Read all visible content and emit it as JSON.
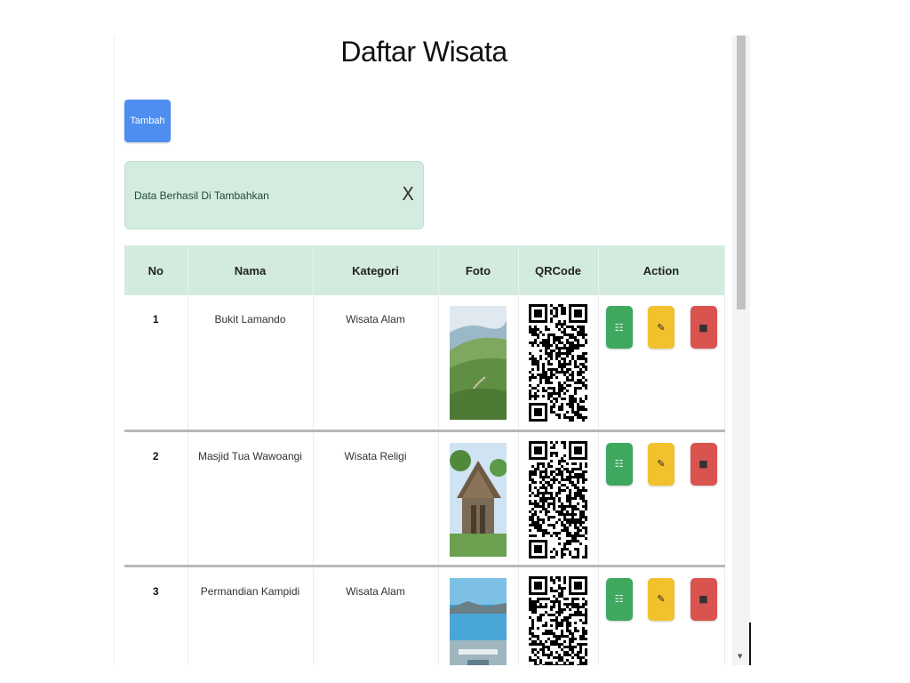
{
  "page": {
    "title": "Daftar Wisata",
    "add_button": "Tambah",
    "alert": {
      "message": "Data Berhasil Di Tambahkan",
      "close": "X"
    }
  },
  "table": {
    "headers": {
      "no": "No",
      "nama": "Nama",
      "kategori": "Kategori",
      "foto": "Foto",
      "qrcode": "QRCode",
      "action": "Action"
    },
    "rows": [
      {
        "no": "1",
        "nama": "Bukit Lamando",
        "kategori": "Wisata Alam"
      },
      {
        "no": "2",
        "nama": "Masjid Tua Wawoangi",
        "kategori": "Wisata Religi"
      },
      {
        "no": "3",
        "nama": "Permandian Kampidi",
        "kategori": "Wisata Alam"
      }
    ]
  },
  "colors": {
    "primary": "#4d8ef0",
    "success": "#3fa85f",
    "warning": "#f2c12e",
    "danger": "#d9534f",
    "alert_bg": "#d4ebdf",
    "header_bg": "#d2ebdc"
  },
  "icons": {
    "detail": "list-icon",
    "edit": "edit-icon",
    "delete": "trash-icon",
    "close": "close-icon"
  }
}
